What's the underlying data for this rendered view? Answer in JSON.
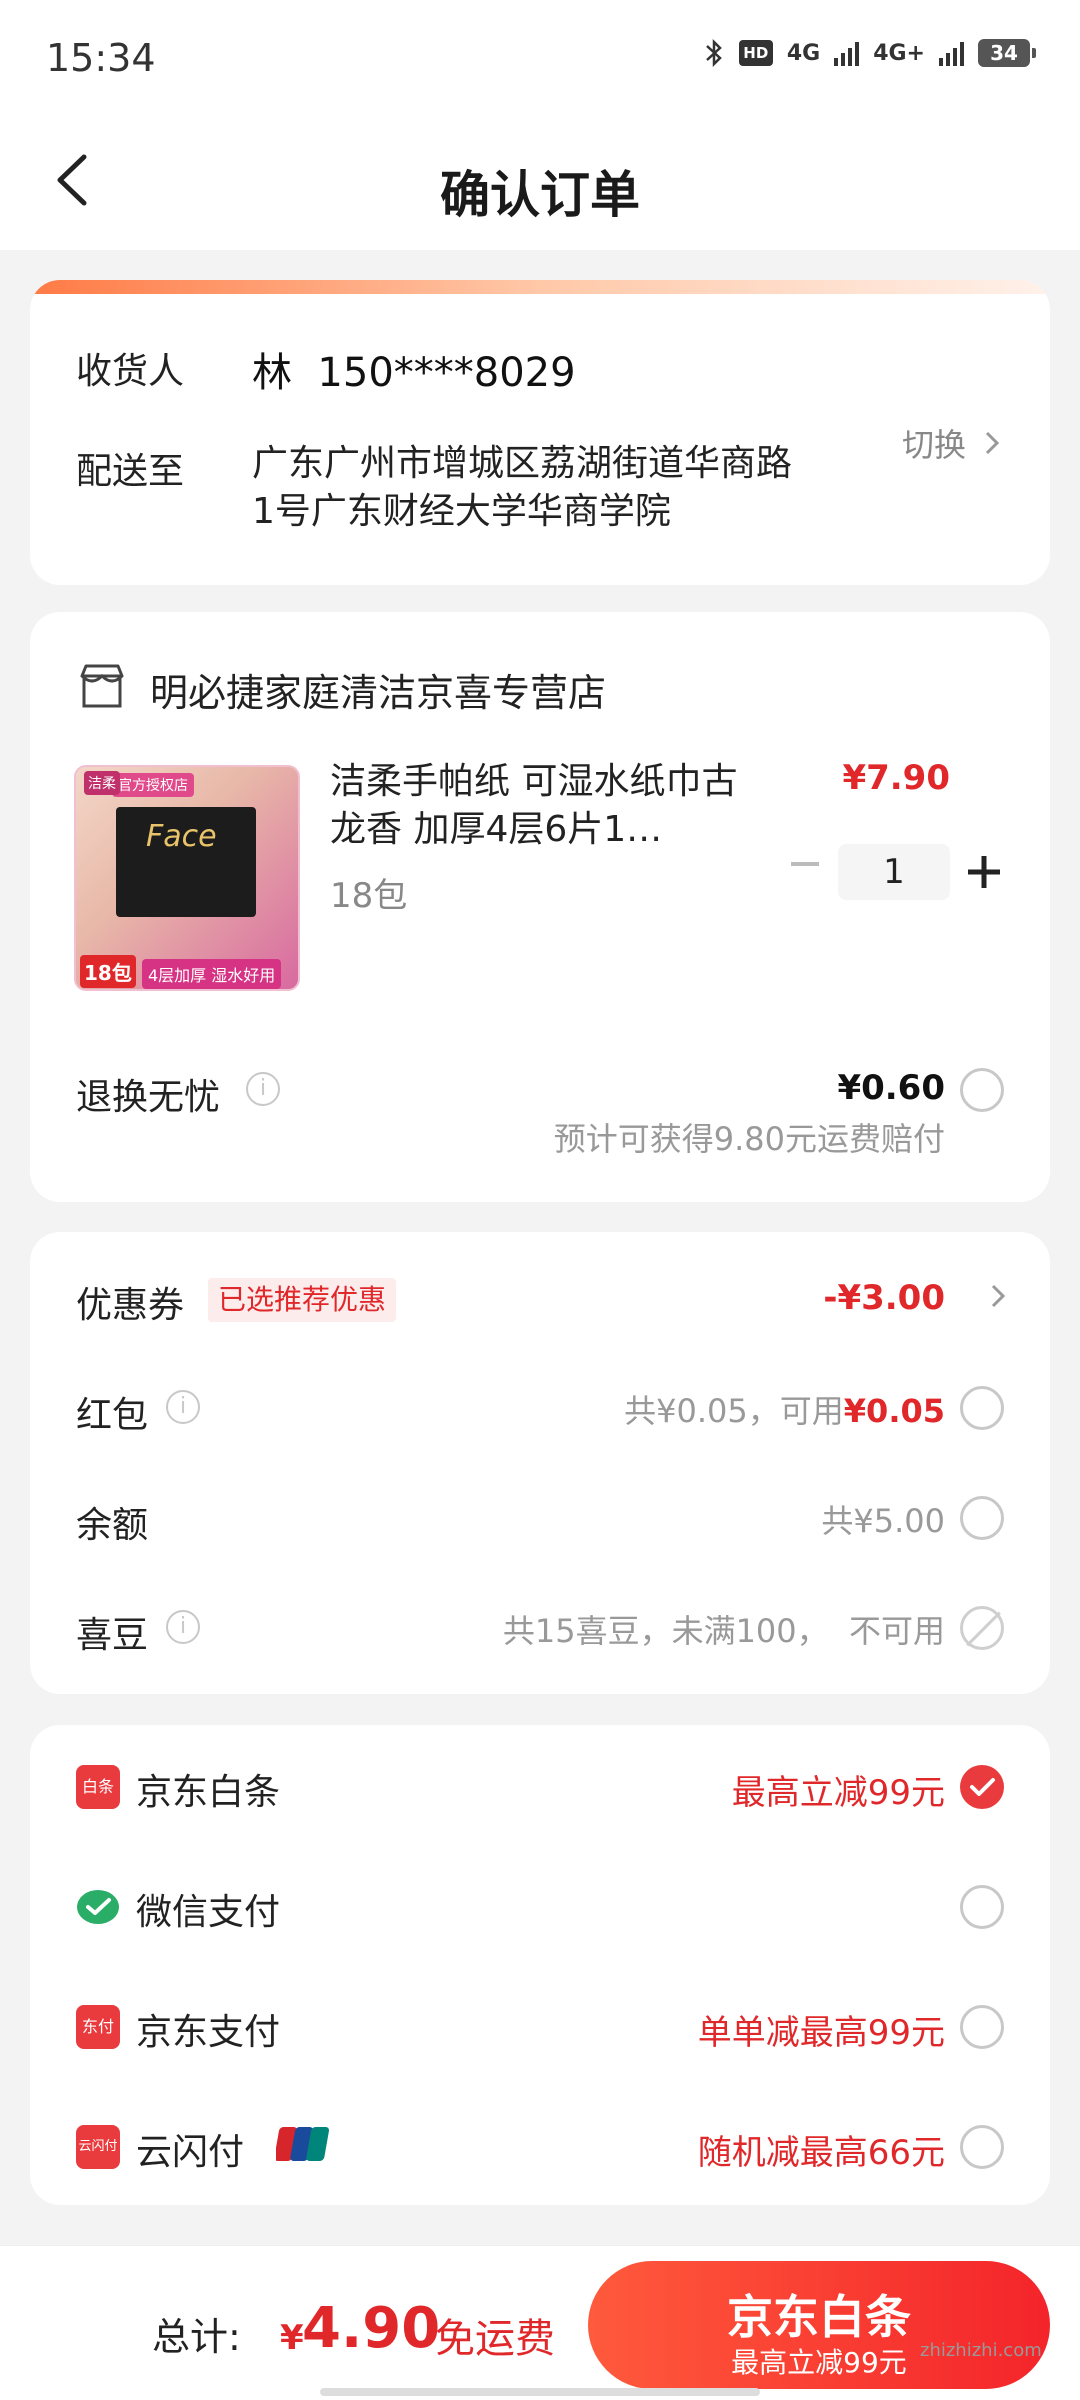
{
  "status_bar": {
    "time": "15:34",
    "battery": "34",
    "network1": "4G",
    "network2": "4G+",
    "hd": "HD"
  },
  "header": {
    "title": "确认订单"
  },
  "address": {
    "receiver_label": "收货人",
    "receiver_value": "林  150****8029",
    "ship_label": "配送至",
    "ship_address": "广东广州市增城区荔湖街道华商路1号广东财经大学华商学院",
    "switch_label": "切换"
  },
  "store": {
    "name": "明必捷家庭清洁京喜专营店",
    "product": {
      "title": "洁柔手帕纸 可湿水纸巾古龙香 加厚4层6片1…",
      "spec": "18包",
      "price": "¥7.90",
      "quantity": "1",
      "image_text": {
        "badge": "官方授权店",
        "brand": "洁柔",
        "line": "Face",
        "promo": "4层加厚 湿水好用",
        "count": "18包"
      }
    },
    "return_service": {
      "label": "退换无忧",
      "price": "¥0.60",
      "note": "预计可获得9.80元运费赔付"
    }
  },
  "discounts": {
    "coupon": {
      "label": "优惠券",
      "tag": "已选推荐优惠",
      "value": "-¥3.00"
    },
    "red_packet": {
      "label": "红包",
      "prefix": "共¥0.05，可用",
      "available": "¥0.05"
    },
    "balance": {
      "label": "余额",
      "value": "共¥5.00"
    },
    "beans": {
      "label": "喜豆",
      "value": "共15喜豆，未满100，  不可用"
    }
  },
  "payments": [
    {
      "label": "京东白条",
      "promo": "最高立减99元",
      "selected": true
    },
    {
      "label": "微信支付",
      "promo": "",
      "selected": false
    },
    {
      "label": "京东支付",
      "promo": "单单减最高99元",
      "selected": false
    },
    {
      "label": "云闪付",
      "promo": "随机减最高66元",
      "selected": false
    }
  ],
  "bottom_bar": {
    "total_label": "总计:",
    "currency": "¥",
    "total_value": "4.90",
    "free_shipping": "免运费",
    "submit_main": "京东白条",
    "submit_sub": "最高立减99元"
  },
  "watermark": "zhizhizhi.com",
  "colors": {
    "accent_red": "#e0282b",
    "button_gradient_start": "#ff5a3c",
    "button_gradient_end": "#f4242a",
    "wechat_green": "#2aae67"
  }
}
